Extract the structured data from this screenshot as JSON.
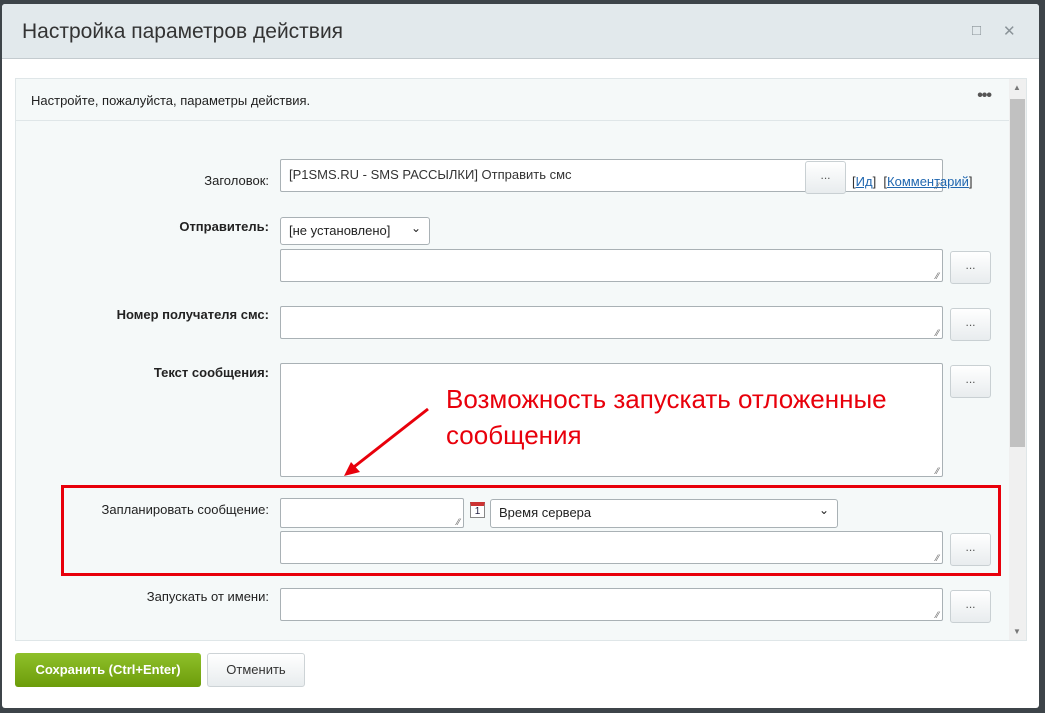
{
  "dialog": {
    "title": "Настройка параметров действия",
    "maximize_icon": "□",
    "close_icon": "✕"
  },
  "panel": {
    "intro": "Настройте, пожалуйста, параметры действия.",
    "more_icon": "•••"
  },
  "fields": {
    "title": {
      "label": "Заголовок:",
      "value": "[P1SMS.RU - SMS РАССЫЛКИ] Отправить смс",
      "btn": "...",
      "link_id": "Ид",
      "link_comment": "Комментарий"
    },
    "sender": {
      "label": "Отправитель:",
      "select": "[не установлено]",
      "btn": "..."
    },
    "phone": {
      "label": "Номер получателя смс:",
      "btn": "..."
    },
    "text": {
      "label": "Текст сообщения:",
      "btn": "..."
    },
    "schedule": {
      "label": "Запланировать сообщение:",
      "calendar_icon": "1",
      "timezone": "Время сервера",
      "btn": "..."
    },
    "run_as": {
      "label": "Запускать от имени:",
      "btn": "..."
    }
  },
  "annotation": {
    "line1": "Возможность запускать отложенные",
    "line2": "сообщения"
  },
  "footer": {
    "save": "Сохранить (Ctrl+Enter)",
    "cancel": "Отменить"
  }
}
